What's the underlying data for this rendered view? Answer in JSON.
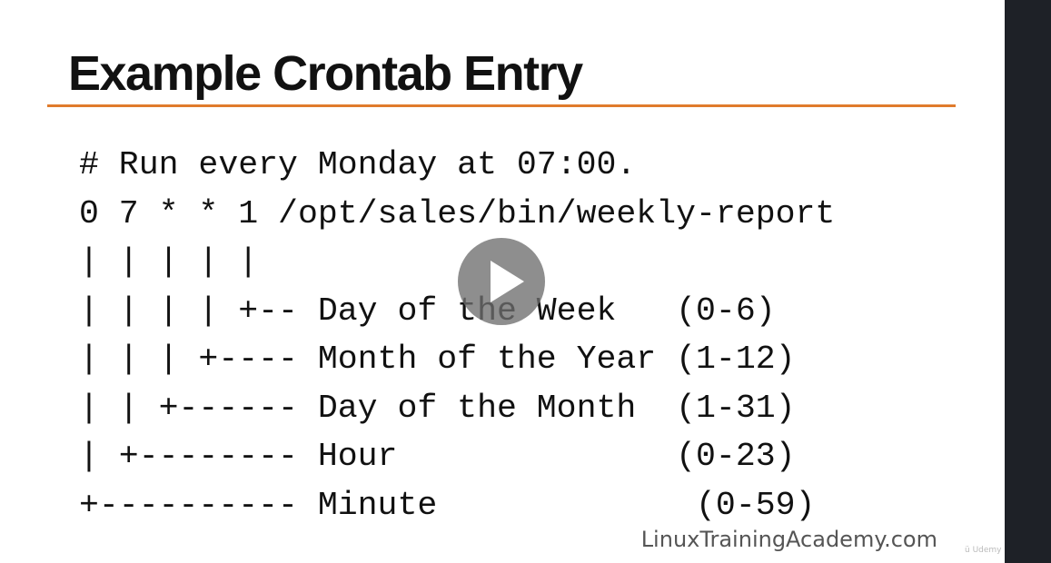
{
  "slide": {
    "title": "Example Crontab Entry",
    "accent_color": "#e07b2c",
    "code_lines": [
      "# Run every Monday at 07:00.",
      "0 7 * * 1 /opt/sales/bin/weekly-report",
      "| | | | |",
      "| | | | +-- Day of the Week   (0-6)",
      "| | | +---- Month of the Year (1-12)",
      "| | +------ Day of the Month  (1-31)",
      "| +-------- Hour              (0-23)",
      "+---------- Minute             (0-59)"
    ],
    "watermark": "LinuxTrainingAcademy.com"
  },
  "player": {
    "play_icon": "play-icon",
    "brand_mark": "udemy"
  }
}
